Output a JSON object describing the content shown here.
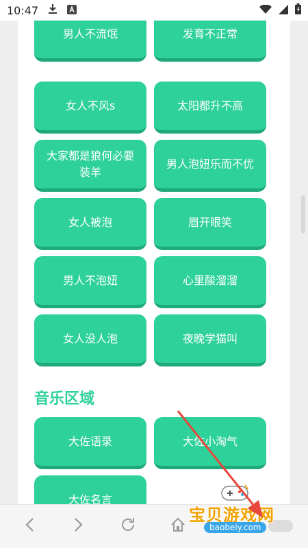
{
  "status_bar": {
    "time": "10:47",
    "icons": [
      "download-icon",
      "a-badge-icon",
      "wifi-icon",
      "signal-icon",
      "battery-icon"
    ]
  },
  "buttons": [
    {
      "label": "男人不流氓",
      "col": "left"
    },
    {
      "label": "发育不正常",
      "col": "right"
    },
    {
      "label": "女人不风s",
      "col": "left"
    },
    {
      "label": "太阳都升不高",
      "col": "right"
    },
    {
      "label": "大家都是狼何必要装羊",
      "col": "left"
    },
    {
      "label": "男人泡妞乐而不优",
      "col": "right"
    },
    {
      "label": "女人被泡",
      "col": "left"
    },
    {
      "label": "眉开眼笑",
      "col": "right"
    },
    {
      "label": "男人不泡妞",
      "col": "left"
    },
    {
      "label": "心里酸溜溜",
      "col": "right"
    },
    {
      "label": "女人没人泡",
      "col": "left"
    },
    {
      "label": "夜晚学猫叫",
      "col": "right"
    }
  ],
  "music_section": {
    "title": "音乐区域",
    "buttons": [
      {
        "label": "大佐语录"
      },
      {
        "label": "大佐小淘气"
      },
      {
        "label": "大佐名言"
      }
    ]
  },
  "nav_bar": {
    "icons": [
      "back-icon",
      "forward-icon",
      "refresh-icon",
      "home-icon"
    ]
  },
  "watermark": {
    "text": "宝贝游戏网",
    "url": "baobeiy.com"
  },
  "colors": {
    "accent": "#2ed19a",
    "accent_dark": "#1ea978",
    "watermark": "#f2a100",
    "arrow": "#e8473c"
  }
}
